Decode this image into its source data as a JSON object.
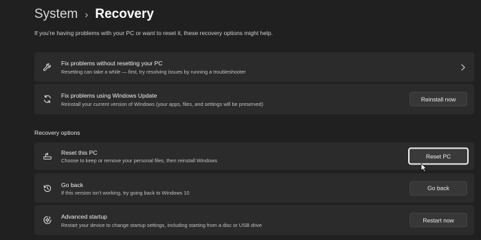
{
  "breadcrumb": {
    "parent": "System",
    "separator": "›",
    "current": "Recovery"
  },
  "intro": "If you're having problems with your PC or want to reset it, these recovery options might help.",
  "top_cards": [
    {
      "icon": "wrench-icon",
      "title": "Fix problems without resetting your PC",
      "description": "Resetting can take a while — first, try resolving issues by running a troubleshooter",
      "action": "chevron-right"
    },
    {
      "icon": "refresh-icon",
      "title": "Fix problems using Windows Update",
      "description": "Reinstall your current version of Windows (your apps, files, and settings will be preserved)",
      "button": "Reinstall now"
    }
  ],
  "recovery_options": {
    "heading": "Recovery options",
    "items": [
      {
        "icon": "reset-pc-icon",
        "title": "Reset this PC",
        "description": "Choose to keep or remove your personal files, then reinstall Windows",
        "button": "Reset PC",
        "focused": true
      },
      {
        "icon": "history-icon",
        "title": "Go back",
        "description": "If this version isn't working, try going back to Windows 10",
        "button": "Go back"
      },
      {
        "icon": "advanced-startup-icon",
        "title": "Advanced startup",
        "description": "Restart your device to change startup settings, including starting from a disc or USB drive",
        "button": "Restart now"
      }
    ]
  },
  "colors": {
    "background": "#202020",
    "card": "#2b2b2b",
    "button": "#373737",
    "text": "#ffffff",
    "secondary_text": "#c2c2c2"
  }
}
